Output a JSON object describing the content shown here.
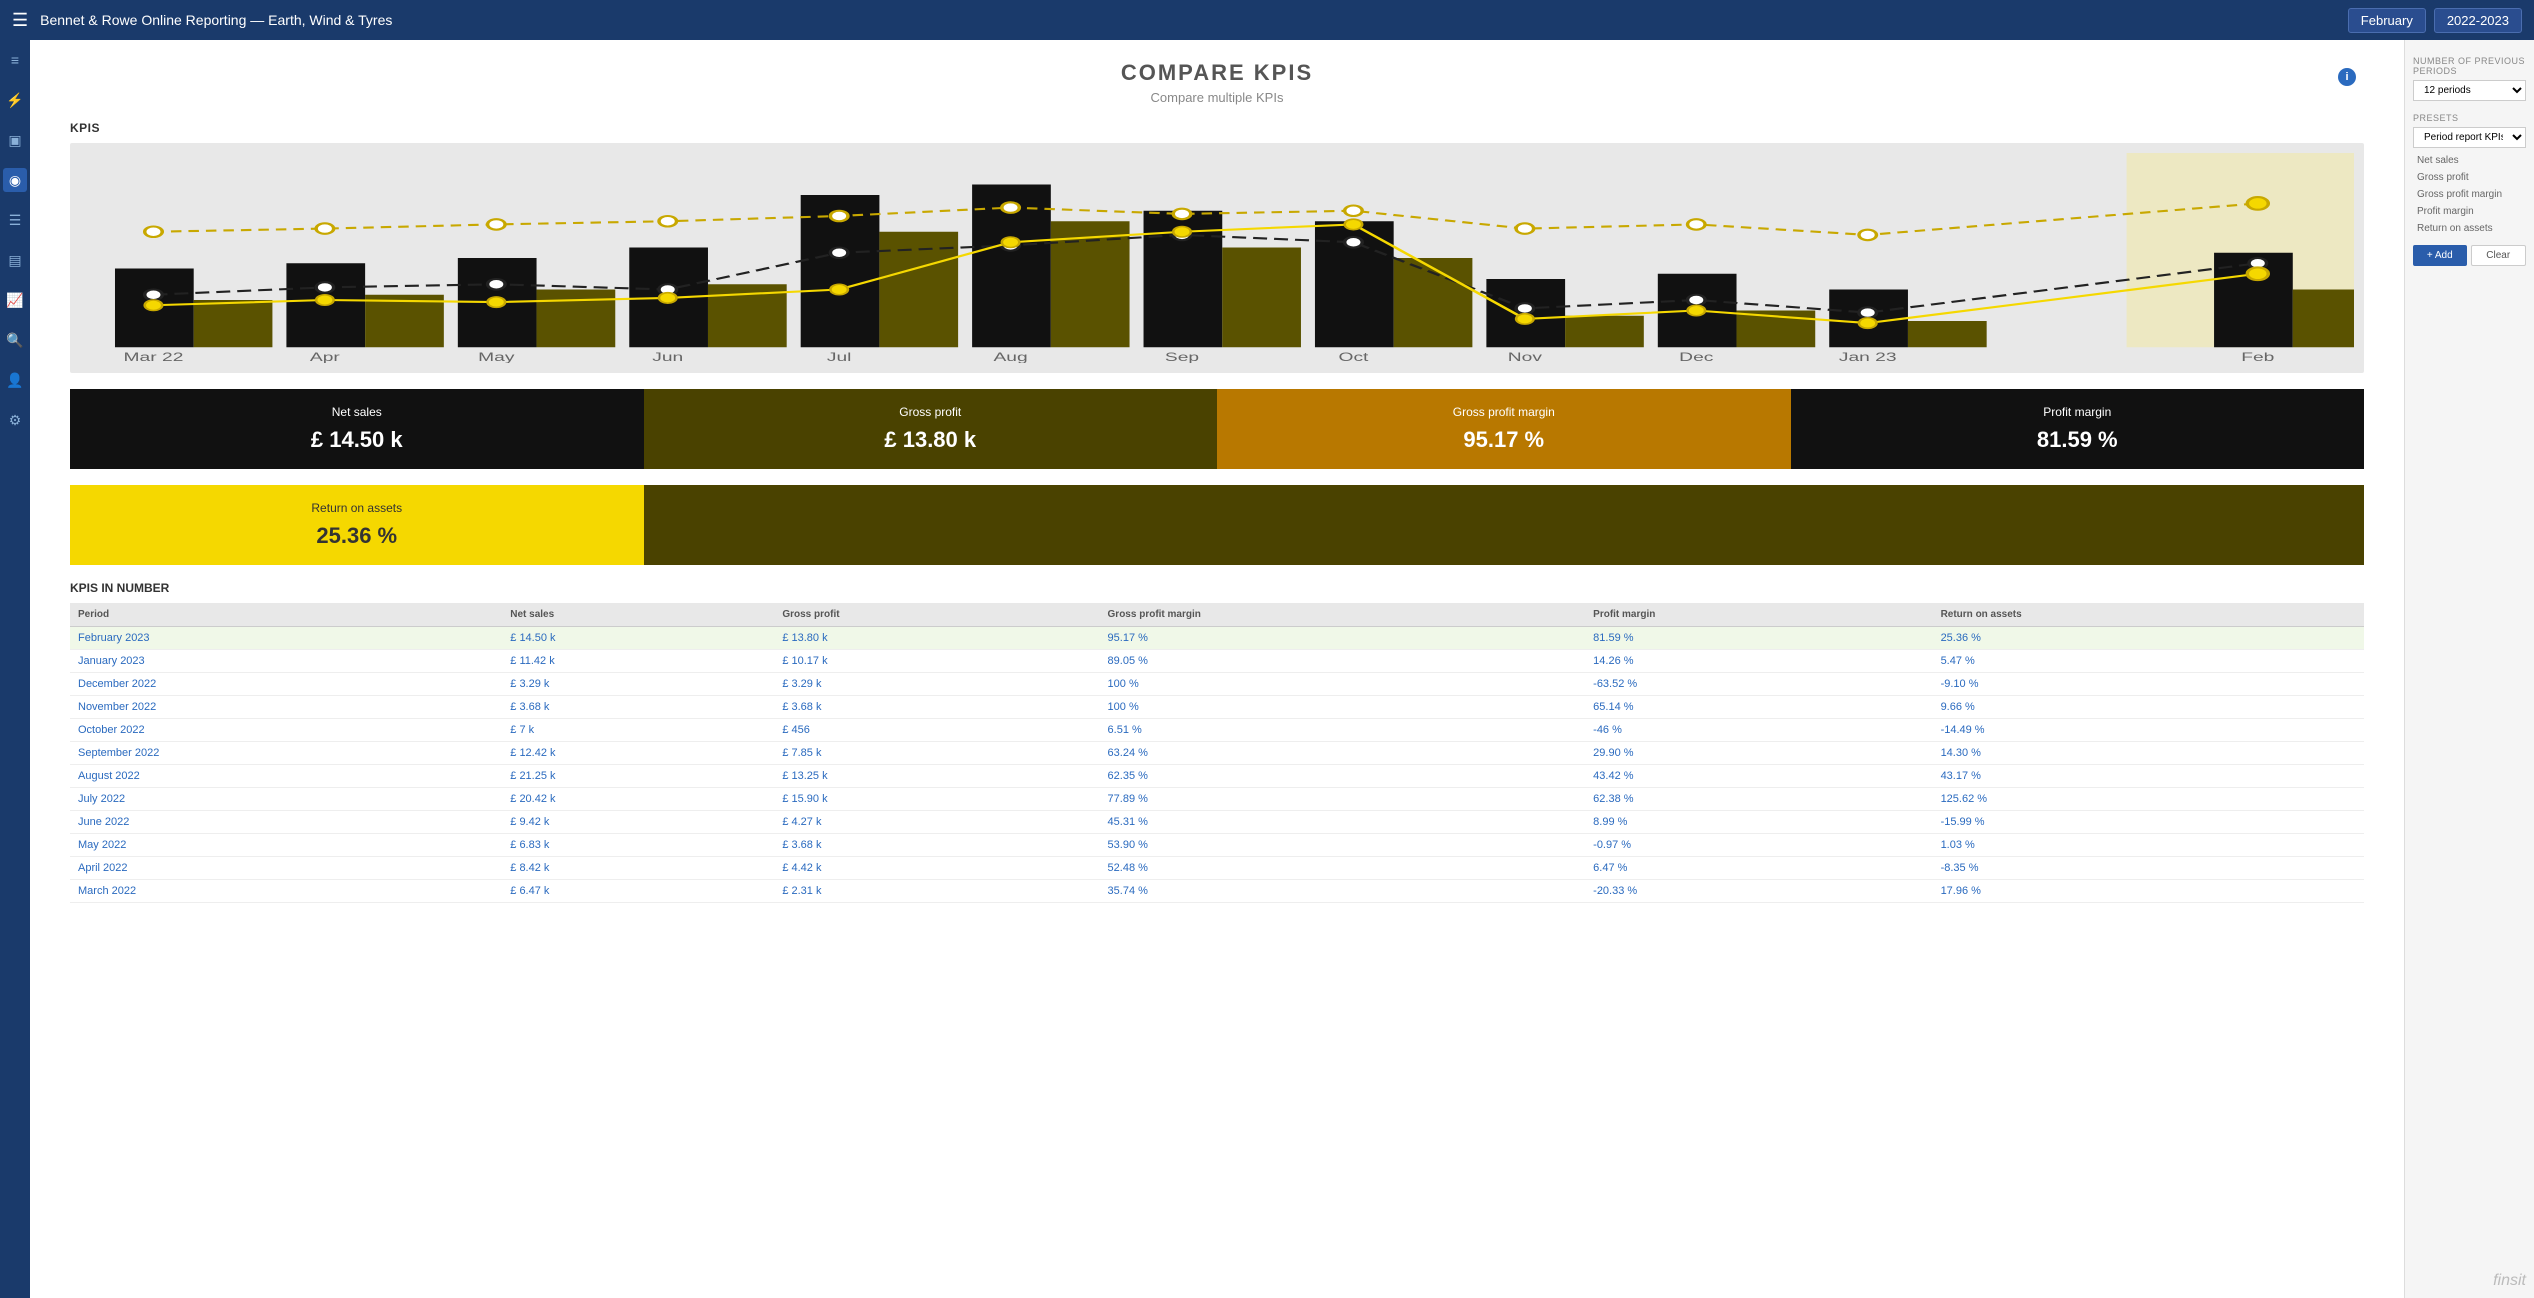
{
  "topNav": {
    "menuIcon": "☰",
    "title": "Bennet & Rowe Online Reporting — Earth, Wind & Tyres",
    "monthDropdown": "February",
    "yearDropdown": "2022-2023"
  },
  "sidebar": {
    "icons": [
      "≡",
      "⚡",
      "▣",
      "◉",
      "☰",
      "▤",
      "🔍",
      "👤",
      "⚙"
    ]
  },
  "pageHeader": {
    "title": "COMPARE KPIS",
    "subtitle": "Compare multiple KPIs"
  },
  "kpisLabel": "KPIS",
  "kpiCards": [
    {
      "label": "Net sales",
      "value": "£ 14.50 k",
      "style": "black"
    },
    {
      "label": "Gross profit",
      "value": "£ 13.80 k",
      "style": "dark-olive"
    },
    {
      "label": "Gross profit margin",
      "value": "95.17 %",
      "style": "amber"
    },
    {
      "label": "Profit margin",
      "value": "81.59 %",
      "style": "black"
    },
    {
      "label": "Return on assets",
      "value": "25.36 %",
      "style": "yellow"
    }
  ],
  "tableTitle": "KPIS IN NUMBER",
  "tableHeaders": [
    "Period",
    "Net sales",
    "Gross profit",
    "Gross profit margin",
    "Profit margin",
    "Return on assets"
  ],
  "tableRows": [
    {
      "period": "February 2023",
      "netSales": "£ 14.50 k",
      "grossProfit": "£ 13.80 k",
      "grossProfitMargin": "95.17 %",
      "profitMargin": "81.59 %",
      "returnOnAssets": "25.36 %",
      "highlighted": true
    },
    {
      "period": "January 2023",
      "netSales": "£ 11.42 k",
      "grossProfit": "£ 10.17 k",
      "grossProfitMargin": "89.05 %",
      "profitMargin": "14.26 %",
      "returnOnAssets": "5.47 %",
      "highlighted": false
    },
    {
      "period": "December 2022",
      "netSales": "£ 3.29 k",
      "grossProfit": "£ 3.29 k",
      "grossProfitMargin": "100 %",
      "profitMargin": "-63.52 %",
      "returnOnAssets": "-9.10 %",
      "highlighted": false
    },
    {
      "period": "November 2022",
      "netSales": "£ 3.68 k",
      "grossProfit": "£ 3.68 k",
      "grossProfitMargin": "100 %",
      "profitMargin": "65.14 %",
      "returnOnAssets": "9.66 %",
      "highlighted": false
    },
    {
      "period": "October 2022",
      "netSales": "£ 7 k",
      "grossProfit": "£ 456",
      "grossProfitMargin": "6.51 %",
      "profitMargin": "-46 %",
      "returnOnAssets": "-14.49 %",
      "highlighted": false
    },
    {
      "period": "September 2022",
      "netSales": "£ 12.42 k",
      "grossProfit": "£ 7.85 k",
      "grossProfitMargin": "63.24 %",
      "profitMargin": "29.90 %",
      "returnOnAssets": "14.30 %",
      "highlighted": false
    },
    {
      "period": "August 2022",
      "netSales": "£ 21.25 k",
      "grossProfit": "£ 13.25 k",
      "grossProfitMargin": "62.35 %",
      "profitMargin": "43.42 %",
      "returnOnAssets": "43.17 %",
      "highlighted": false
    },
    {
      "period": "July 2022",
      "netSales": "£ 20.42 k",
      "grossProfit": "£ 15.90 k",
      "grossProfitMargin": "77.89 %",
      "profitMargin": "62.38 %",
      "returnOnAssets": "125.62 %",
      "highlighted": false
    },
    {
      "period": "June 2022",
      "netSales": "£ 9.42 k",
      "grossProfit": "£ 4.27 k",
      "grossProfitMargin": "45.31 %",
      "profitMargin": "8.99 %",
      "returnOnAssets": "-15.99 %",
      "highlighted": false
    },
    {
      "period": "May 2022",
      "netSales": "£ 6.83 k",
      "grossProfit": "£ 3.68 k",
      "grossProfitMargin": "53.90 %",
      "profitMargin": "-0.97 %",
      "returnOnAssets": "1.03 %",
      "highlighted": false
    },
    {
      "period": "April 2022",
      "netSales": "£ 8.42 k",
      "grossProfit": "£ 4.42 k",
      "grossProfitMargin": "52.48 %",
      "profitMargin": "6.47 %",
      "returnOnAssets": "-8.35 %",
      "highlighted": false
    },
    {
      "period": "March 2022",
      "netSales": "£ 6.47 k",
      "grossProfit": "£ 2.31 k",
      "grossProfitMargin": "35.74 %",
      "profitMargin": "-20.33 %",
      "returnOnAssets": "17.96 %",
      "highlighted": false
    }
  ],
  "rightPanel": {
    "periodsLabel": "NUMBER OF PREVIOUS PERIODS",
    "periodsValue": "12 periods",
    "presetsLabel": "PRESETS",
    "presetsValue": "Period report KPIs",
    "kpiOptions": [
      "Net sales",
      "Gross profit",
      "Gross profit margin",
      "Profit margin",
      "Return on assets"
    ],
    "addLabel": "+ Add",
    "clearLabel": "Clear"
  },
  "finsitLogo": "finsit",
  "chartMonths": [
    "Mar 22",
    "Apr",
    "May",
    "Jun",
    "Jul",
    "Aug",
    "Sep",
    "Oct",
    "Nov",
    "Dec",
    "Jan 23",
    "Feb"
  ]
}
